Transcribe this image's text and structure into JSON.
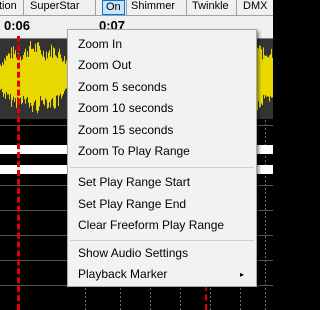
{
  "toolbar": {
    "items": [
      "tion",
      "SuperStar",
      "On",
      "Shimmer",
      "Twinkle",
      "DMX"
    ],
    "active_item": "On"
  },
  "ruler": {
    "labels": [
      "0:06",
      "0:07"
    ]
  },
  "colors": {
    "waveform": "#e8d800",
    "waveform_bg": "#333333",
    "play_marker": "#e00000",
    "menu_bg": "#f2f2f2"
  },
  "context_menu": {
    "groups": [
      [
        "Zoom In",
        "Zoom Out",
        "Zoom 5 seconds",
        "Zoom 10 seconds",
        "Zoom 15 seconds",
        "Zoom To Play Range"
      ],
      [
        "Set Play Range Start",
        "Set Play Range End",
        "Clear Freeform Play Range"
      ],
      [
        "Show Audio Settings",
        "Playback Marker"
      ]
    ],
    "submenu_item": "Playback Marker",
    "submenu_arrow": "▸"
  }
}
